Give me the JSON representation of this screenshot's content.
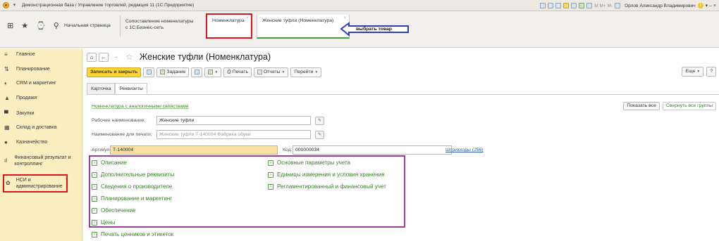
{
  "window": {
    "title": "Демонстрационная база / Управление торговлей, редакция 11  (1С:Предприятие)",
    "user": "Орлов Александр Владимирович",
    "toolbar_text": "M  M+  M-"
  },
  "tabs": {
    "home": "Начальная страница",
    "compare_line1": "Сопоставление номенклатуры",
    "compare_line2": "с 1С:Бизнес-сеть",
    "nomenclature": "Номенклатура",
    "shoes": "Женские туфли (Номенклатура)",
    "close_symbol": "×"
  },
  "annotation": {
    "callout": "выбрать товар"
  },
  "sidebar": {
    "items": [
      {
        "label": "Главное",
        "icon": "menu-icon",
        "glyph": "≡"
      },
      {
        "label": "Планирование",
        "icon": "chart-icon",
        "glyph": "⇅"
      },
      {
        "label": "CRM и маркетинг",
        "icon": "crm-icon",
        "glyph": "◐"
      },
      {
        "label": "Продажи",
        "icon": "sales-icon",
        "glyph": "▲"
      },
      {
        "label": "Закупки",
        "icon": "cart-icon",
        "glyph": "▀"
      },
      {
        "label": "Склад и доставка",
        "icon": "warehouse-icon",
        "glyph": "▦"
      },
      {
        "label": "Казначейство",
        "icon": "treasury-icon",
        "glyph": "●"
      },
      {
        "label": "Финансовый результат и контроллинг",
        "icon": "finance-icon",
        "glyph": "ıl"
      },
      {
        "label": "НСИ и администрирование",
        "icon": "settings-icon",
        "glyph": "✿"
      }
    ]
  },
  "header": {
    "title": "Женские туфли (Номенклатура)"
  },
  "toolbar": {
    "save_close": "Записать и закрыть",
    "task": "Задание",
    "print": "Печать",
    "reports": "Отчеты",
    "goto": "Перейти",
    "more": "Еще",
    "help": "?"
  },
  "form_tabs": {
    "card": "Карточка",
    "requisites": "Реквизиты"
  },
  "links": {
    "similar": "Номенклатура с аналогичными свойствами",
    "barcodes": "Штрихкоды (256)"
  },
  "group_buttons": {
    "show_all": "Показать все",
    "collapse_all": "Свернуть все группы"
  },
  "fields": {
    "work_name_label": "Рабочее наименование:",
    "work_name_value": "Женские туфли",
    "print_name_label": "Наименование для печати:",
    "print_name_value": "Женские туфли Т-140004 Фабрика обуви",
    "article_label": "Артикул:",
    "article_value": "Т-140004",
    "code_label": "Код:",
    "code_value": "000000034"
  },
  "groups": {
    "left": [
      "Описание",
      "Дополнительные реквизиты",
      "Сведения о производителе",
      "Планирование и маркетинг",
      "Обеспечение",
      "Цены"
    ],
    "right": [
      "Основные параметры учета",
      "Единицы измерения и условия хранения",
      "Регламентированный и финансовый учет"
    ],
    "extra": "Печать ценников и этикеток"
  },
  "colors": {
    "accent_yellow": "#fbd436",
    "sidebar_bg": "#fbeec1",
    "link_green": "#3a7d2a",
    "highlight_red": "#e0141e",
    "highlight_purple": "#9d3f9c",
    "callout_blue": "#2f3fb8"
  }
}
